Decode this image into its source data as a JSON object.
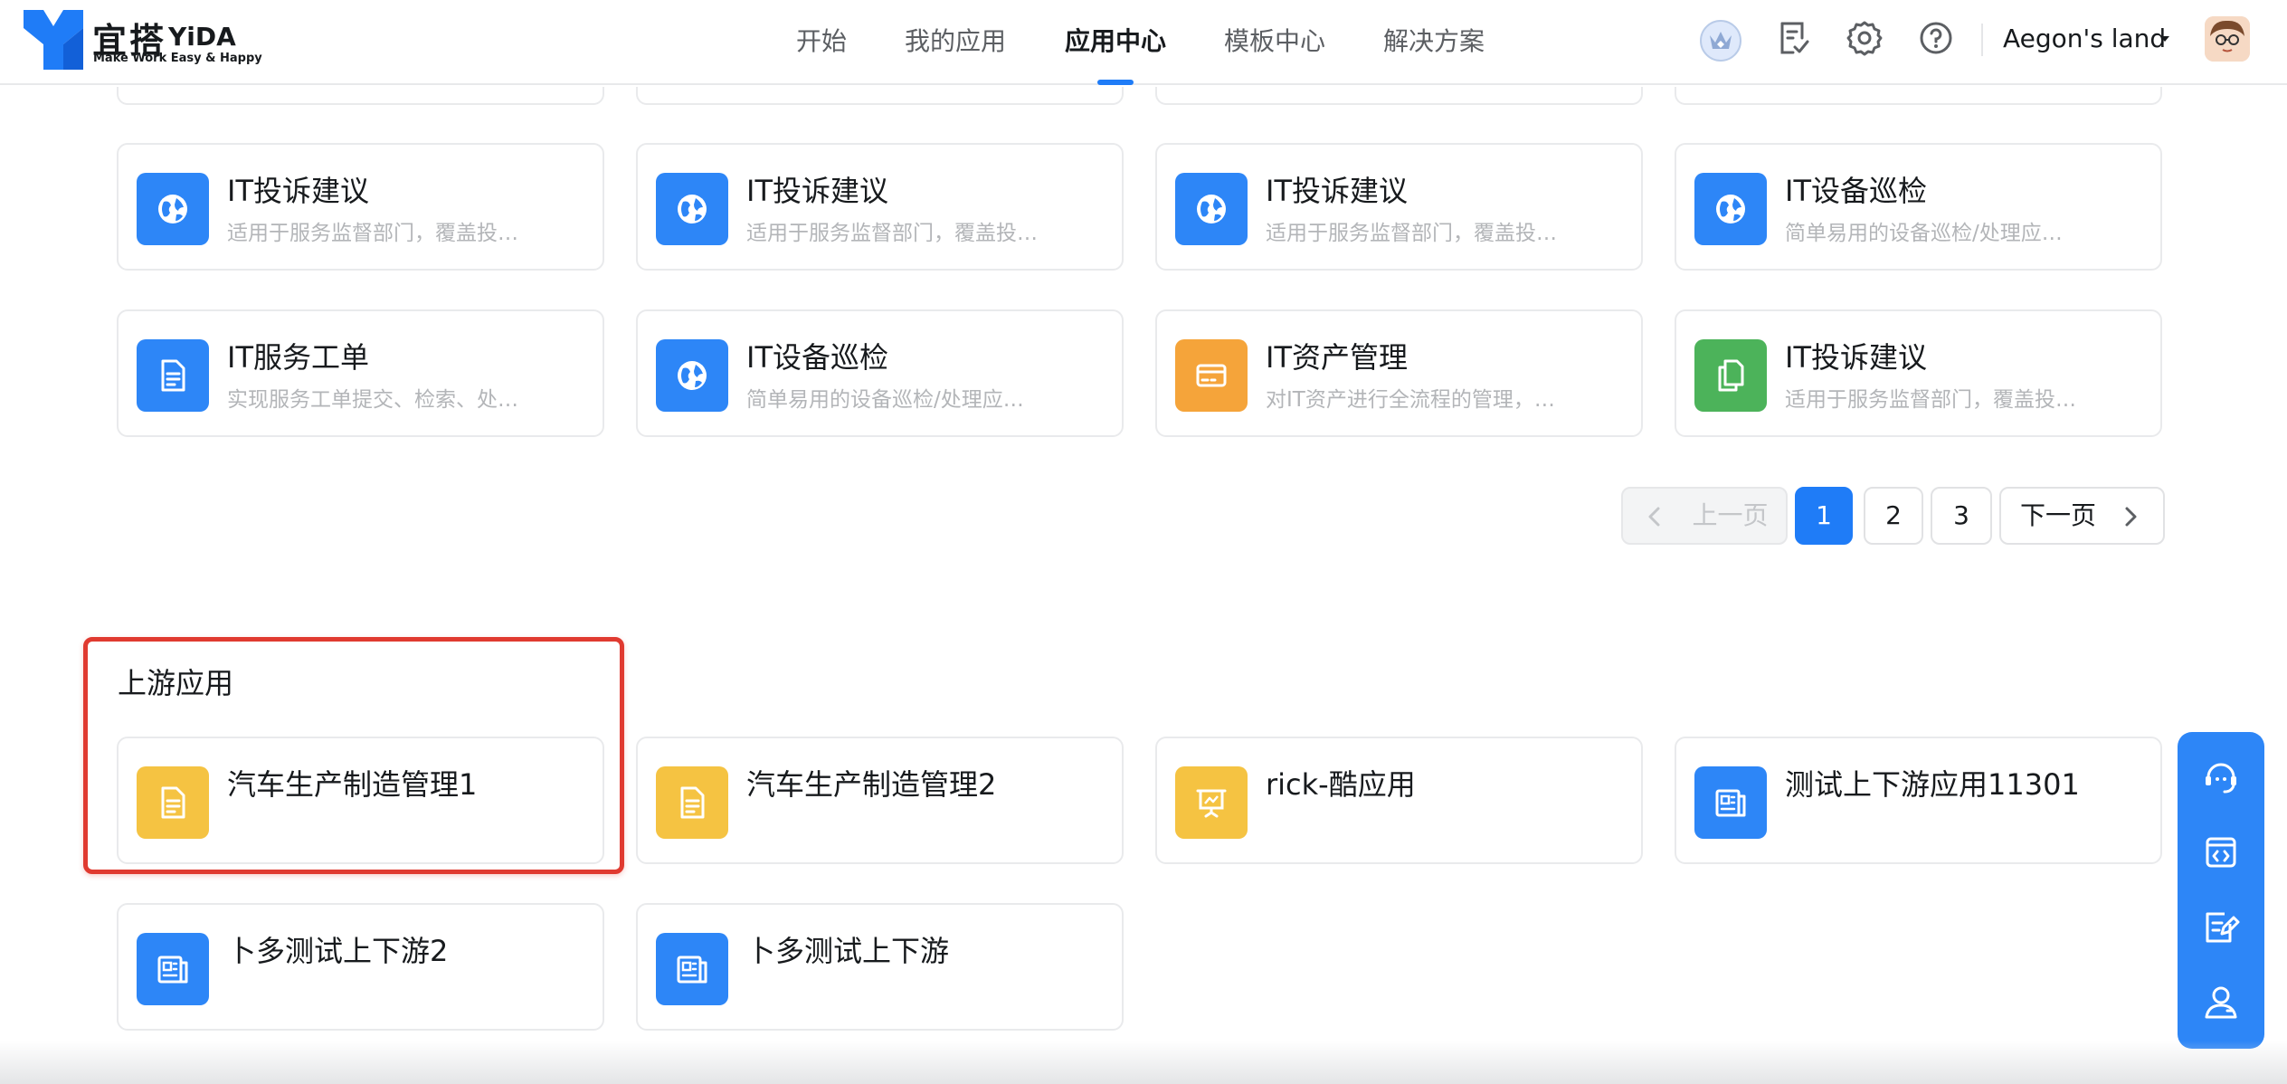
{
  "header": {
    "logo_cn": "宜搭",
    "logo_en": "YiDA",
    "logo_slogan": "Make Work Easy & Happy",
    "nav": [
      "开始",
      "我的应用",
      "应用中心",
      "模板中心",
      "解决方案"
    ],
    "nav_active": "应用中心",
    "user_name": "Aegon's land",
    "accent_color": "#1f7cf7"
  },
  "app_grid": {
    "cards": [
      {
        "title": "IT投诉建议",
        "desc": "适用于服务监督部门，覆盖投…",
        "icon": "globe-icon",
        "color": "#2d86f7"
      },
      {
        "title": "IT投诉建议",
        "desc": "适用于服务监督部门，覆盖投…",
        "icon": "globe-icon",
        "color": "#2d86f7"
      },
      {
        "title": "IT投诉建议",
        "desc": "适用于服务监督部门，覆盖投…",
        "icon": "globe-icon",
        "color": "#2d86f7"
      },
      {
        "title": "IT设备巡检",
        "desc": "简单易用的设备巡检/处理应…",
        "icon": "globe-icon",
        "color": "#2d86f7"
      },
      {
        "title": "IT服务工单",
        "desc": "实现服务工单提交、检索、处…",
        "icon": "document-icon",
        "color": "#2d86f7"
      },
      {
        "title": "IT设备巡检",
        "desc": "简单易用的设备巡检/处理应…",
        "icon": "globe-icon",
        "color": "#2d86f7"
      },
      {
        "title": "IT资产管理",
        "desc": "对IT资产进行全流程的管理，…",
        "icon": "card-icon",
        "color": "#f5a43a"
      },
      {
        "title": "IT投诉建议",
        "desc": "适用于服务监督部门，覆盖投…",
        "icon": "copy-icon",
        "color": "#4cb35a"
      }
    ]
  },
  "pagination": {
    "prev_label": "上一页",
    "pages": [
      "1",
      "2",
      "3"
    ],
    "current_page": "1",
    "next_label": "下一页"
  },
  "upstream": {
    "title": "上游应用",
    "cards": [
      {
        "title": "汽车生产制造管理1",
        "icon": "document-icon",
        "color": "#f5c342"
      },
      {
        "title": "汽车生产制造管理2",
        "icon": "document-icon",
        "color": "#f5c342"
      },
      {
        "title": "rick-酷应用",
        "icon": "presentation-icon",
        "color": "#f5c342"
      },
      {
        "title": "测试上下游应用11301",
        "icon": "newspaper-icon",
        "color": "#2d86f7"
      },
      {
        "title": "卜多测试上下游2",
        "icon": "newspaper-icon",
        "color": "#2d86f7"
      },
      {
        "title": "卜多测试上下游",
        "icon": "newspaper-icon",
        "color": "#2d86f7"
      }
    ]
  },
  "float_toolbar": [
    "customer-service-icon",
    "code-icon",
    "edit-form-icon",
    "user-contact-icon"
  ]
}
